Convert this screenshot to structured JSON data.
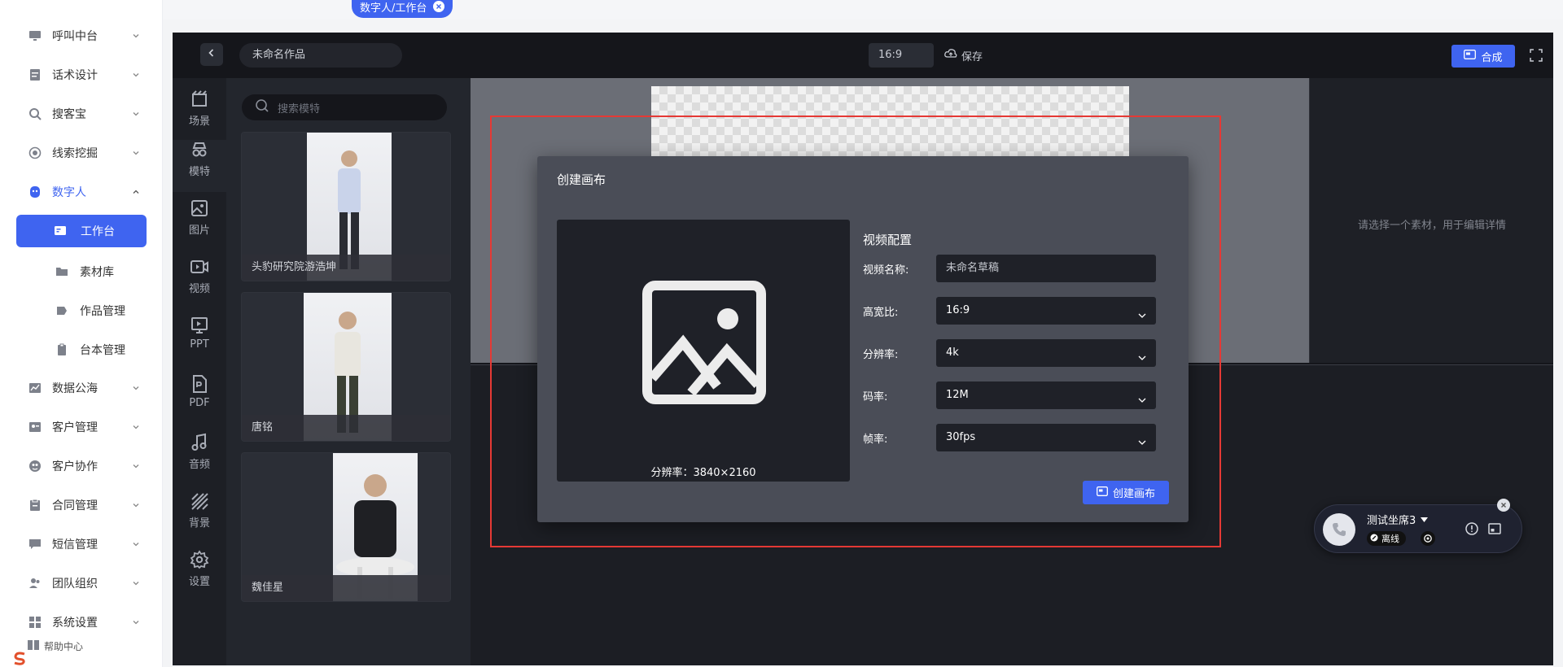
{
  "nav": {
    "items": [
      {
        "label": "呼叫中台",
        "icon": "monitor-icon"
      },
      {
        "label": "话术设计",
        "icon": "script-icon"
      },
      {
        "label": "搜客宝",
        "icon": "search-customer-icon"
      },
      {
        "label": "线索挖掘",
        "icon": "target-icon"
      },
      {
        "label": "数字人",
        "icon": "digital-human-icon"
      },
      {
        "label": "工作台",
        "icon": "workbench-icon"
      },
      {
        "label": "素材库",
        "icon": "folder-icon"
      },
      {
        "label": "作品管理",
        "icon": "works-icon"
      },
      {
        "label": "台本管理",
        "icon": "clipboard-icon"
      },
      {
        "label": "数据公海",
        "icon": "chart-icon"
      },
      {
        "label": "客户管理",
        "icon": "customer-icon"
      },
      {
        "label": "客户协作",
        "icon": "collab-icon"
      },
      {
        "label": "合同管理",
        "icon": "contract-icon"
      },
      {
        "label": "短信管理",
        "icon": "sms-icon"
      },
      {
        "label": "团队组织",
        "icon": "team-icon"
      },
      {
        "label": "系统设置",
        "icon": "settings-grid-icon"
      }
    ],
    "help_label": "帮助中心"
  },
  "tab": {
    "label": "数字人/工作台"
  },
  "editor": {
    "title": "未命名作品",
    "ratio": "16:9",
    "save_label": "保存",
    "compose_label": "合成",
    "tools": [
      {
        "label": "场景",
        "icon": "scene-icon"
      },
      {
        "label": "模特",
        "icon": "model-icon"
      },
      {
        "label": "图片",
        "icon": "image-icon"
      },
      {
        "label": "视频",
        "icon": "video-icon"
      },
      {
        "label": "PPT",
        "icon": "ppt-icon"
      },
      {
        "label": "PDF",
        "icon": "pdf-icon"
      },
      {
        "label": "音频",
        "icon": "audio-icon"
      },
      {
        "label": "背景",
        "icon": "background-icon"
      },
      {
        "label": "设置",
        "icon": "gear-icon"
      }
    ],
    "search_placeholder": "搜索模特",
    "models": [
      {
        "name": "头豹研究院游浩坤"
      },
      {
        "name": "唐铭"
      },
      {
        "name": "魏佳星"
      }
    ],
    "right_hint": "请选择一个素材，用于编辑详情"
  },
  "modal": {
    "title": "创建画布",
    "preview_resolution": "分辨率：3840×2160",
    "config_title": "视频配置",
    "fields": [
      {
        "label": "视频名称:",
        "value": "未命名草稿"
      },
      {
        "label": "高宽比:",
        "value": "16:9"
      },
      {
        "label": "分辨率:",
        "value": "4k"
      },
      {
        "label": "码率:",
        "value": "12M"
      },
      {
        "label": "帧率:",
        "value": "30fps"
      }
    ],
    "create_label": "创建画布"
  },
  "call": {
    "agent_name": "测试坐席3",
    "status": "离线"
  },
  "colors": {
    "accent": "#3f64f0",
    "highlight": "#e53935",
    "editor_bg": "#15161b",
    "modal_bg": "#4a4d57"
  }
}
